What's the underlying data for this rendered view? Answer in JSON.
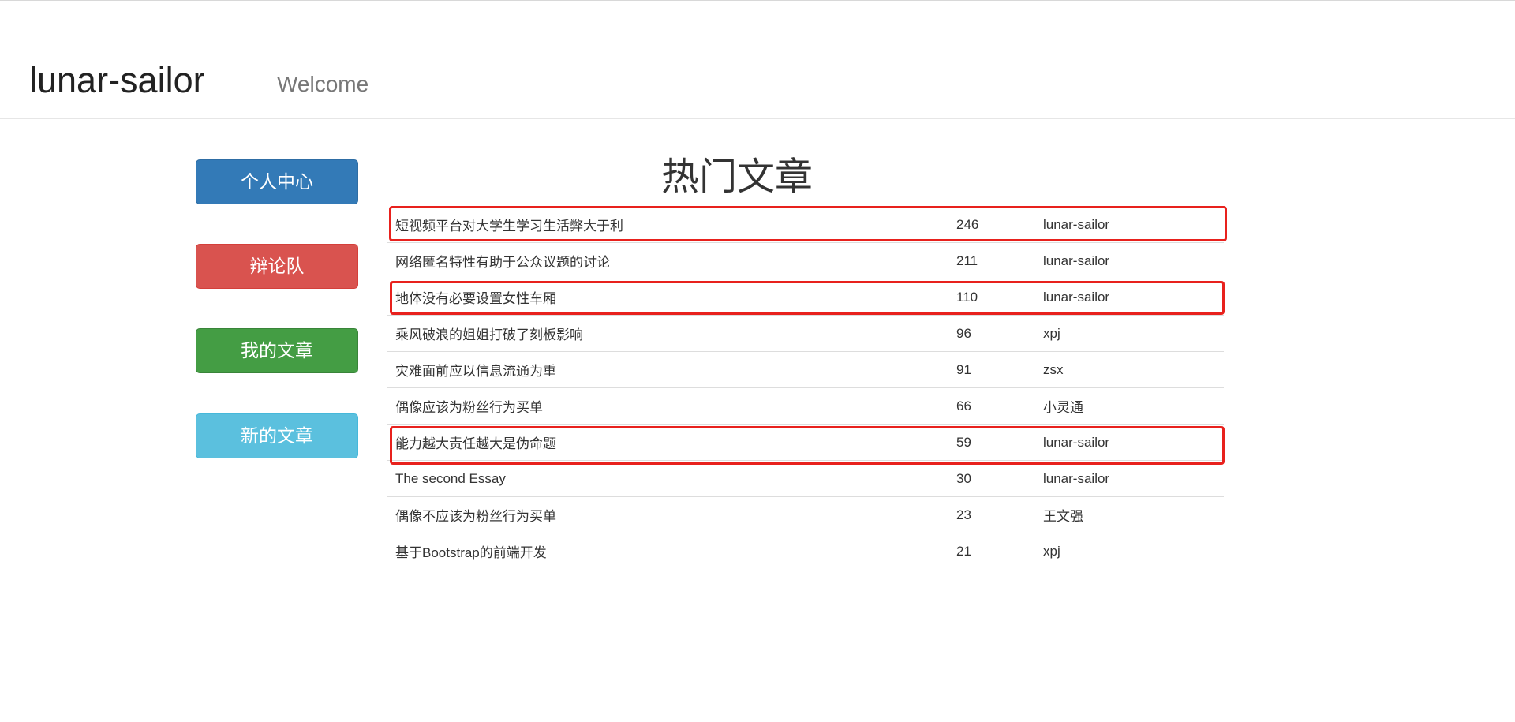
{
  "header": {
    "brand": "lunar-sailor",
    "nav_welcome": "Welcome"
  },
  "sidebar": {
    "buttons": [
      {
        "label": "个人中心",
        "color": "#337ab7"
      },
      {
        "label": "辩论队",
        "color": "#d9534f"
      },
      {
        "label": "我的文章",
        "color": "#449d44"
      },
      {
        "label": "新的文章",
        "color": "#5bc0de"
      }
    ]
  },
  "main": {
    "title": "热门文章",
    "articles": [
      {
        "title": "短视频平台对大学生学习生活弊大于利",
        "views": "246",
        "author": "lunar-sailor",
        "highlighted": true
      },
      {
        "title": "网络匿名特性有助于公众议题的讨论",
        "views": "211",
        "author": "lunar-sailor",
        "highlighted": false
      },
      {
        "title": "地体没有必要设置女性车厢",
        "views": "110",
        "author": "lunar-sailor",
        "highlighted": true
      },
      {
        "title": "乘风破浪的姐姐打破了刻板影响",
        "views": "96",
        "author": "xpj",
        "highlighted": false
      },
      {
        "title": "灾难面前应以信息流通为重",
        "views": "91",
        "author": "zsx",
        "highlighted": false
      },
      {
        "title": "偶像应该为粉丝行为买单",
        "views": "66",
        "author": "小灵通",
        "highlighted": false
      },
      {
        "title": "能力越大责任越大是伪命题",
        "views": "59",
        "author": "lunar-sailor",
        "highlighted": true
      },
      {
        "title": "The second Essay",
        "views": "30",
        "author": "lunar-sailor",
        "highlighted": false
      },
      {
        "title": "偶像不应该为粉丝行为买单",
        "views": "23",
        "author": "王文强",
        "highlighted": false
      },
      {
        "title": "基于Bootstrap的前端开发",
        "views": "21",
        "author": "xpj",
        "highlighted": false
      }
    ],
    "highlight_color": "#e8211d"
  }
}
